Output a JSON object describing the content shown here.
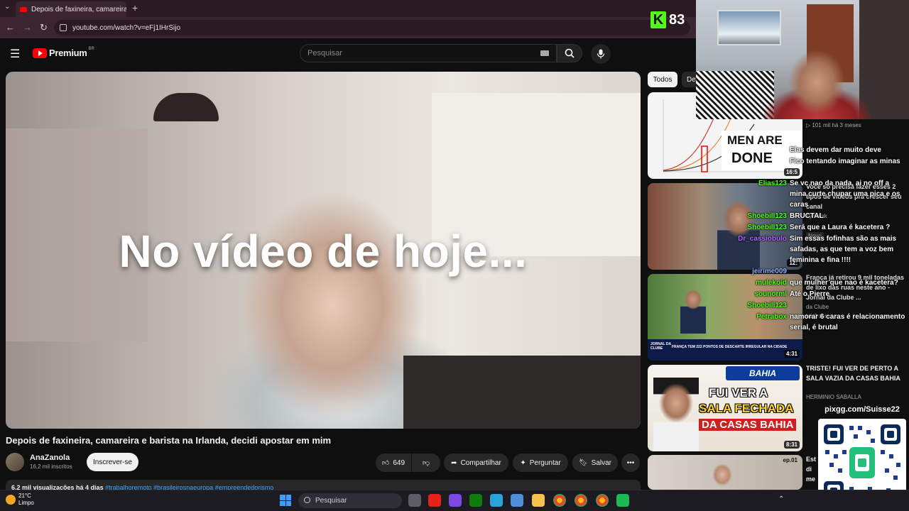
{
  "browser": {
    "tab_title": "Depois de faxineira, camareira e barista na Irlanda, decidi apostar em mim - YouTube",
    "tab_close": "✕",
    "new_tab": "+",
    "url": "youtube.com/watch?v=eFj1IHrSijo"
  },
  "youtube": {
    "logo_word": "Premium",
    "logo_country": "BR",
    "search_placeholder": "Pesquisar"
  },
  "video": {
    "overlay_text": "No vídeo de hoje...",
    "title": "Depois de faxineira, camareira e barista na Irlanda, decidi apostar em mim",
    "channel_name": "AnaZanola",
    "subscribers": "16,2 mil inscritos",
    "subscribe_label": "Inscrever-se",
    "likes": "649",
    "share_label": "Compartilhar",
    "ask_label": "Perguntar",
    "save_label": "Salvar",
    "desc_stats": "6,2 mil visualizações  há 4 dias",
    "desc_tags": "#trabalhoremoto #brasileirosnaeuropa #empreendedorismo"
  },
  "sidebar": {
    "chips": [
      "Todos",
      "De"
    ],
    "items": [
      {
        "thumb_text_line1": "MEN ARE",
        "thumb_text_line2": "DONE",
        "views": "101 mil",
        "age": "há 3 meses",
        "duration": "16:5"
      },
      {
        "title": "Você só precisa fazer esses 2 tipos de vídeos pra crescer seu canal",
        "channel": "Tymniak",
        "badge": "Novo",
        "duration": "12:"
      },
      {
        "title": "França já retirou 9 mil toneladas de lixo das ruas neste ano - Jornal da Clube ...",
        "channel": "da Clube",
        "age": "há 2 sem",
        "duration": "4:31",
        "banner_left": "JORNAL DA CLUBE",
        "banner_right": "FRANÇA TEM 222 PONTOS DE DESCARTE IRREGULAR NA CIDADE"
      },
      {
        "title": "TRISTE! FUI VER DE PERTO A SALA VAZIA DA CASAS BAHIA",
        "channel": "HERMINIO SABALLA",
        "duration": "8:31",
        "thumb_brand": "BAHIA",
        "thumb_line1": "FUI VER A",
        "thumb_line2": "SALA FECHADA",
        "thumb_line3": "DA CASAS BAHIA"
      },
      {
        "title": "Est di me",
        "duration": "ep.01"
      }
    ]
  },
  "stream": {
    "kick_letter": "K",
    "viewer_count": "83",
    "qr_url": "pixgg.com/Suisse22"
  },
  "chat": [
    {
      "user": "",
      "text": "Elas devem dar muito deve",
      "color": "#ffffff"
    },
    {
      "user": "",
      "text": "Fico tentando imaginar as minas",
      "color": "#ffffff"
    },
    {
      "user": "Elias123",
      "text": "Se vc nao da nada, ai no off a mina curte chupar uma pica e os caras",
      "color": "#53fc18"
    },
    {
      "user": "Shoebill123",
      "text": "BRUCTAL",
      "color": "#53fc18"
    },
    {
      "user": "Shoebill123",
      "text": "Será que a Laura é kacetera ?",
      "color": "#53fc18"
    },
    {
      "user": "Dr_cassiobulo",
      "text": "Sim essas fofinhas são as mais safadas, as que tem a voz bem feminina e fina !!!!",
      "color": "#b366ff"
    },
    {
      "user": "jeirime009",
      "text": "",
      "color": "#8fb3ff"
    },
    {
      "user": "mulekoid",
      "text": "que mulher que nao é kacetera?",
      "color": "#53fc18"
    },
    {
      "user": "sounorml",
      "text": "Até o Pierre",
      "color": "#53fc18"
    },
    {
      "user": "Shoebill123",
      "text": "",
      "color": "#53fc18"
    },
    {
      "user": "Petrabox",
      "text": "namorar 6 caras é relacionamento serial, é brutal",
      "color": "#53fc18"
    }
  ],
  "taskbar": {
    "temperature": "21°C",
    "condition": "Limpo",
    "search_placeholder": "Pesquisar"
  }
}
